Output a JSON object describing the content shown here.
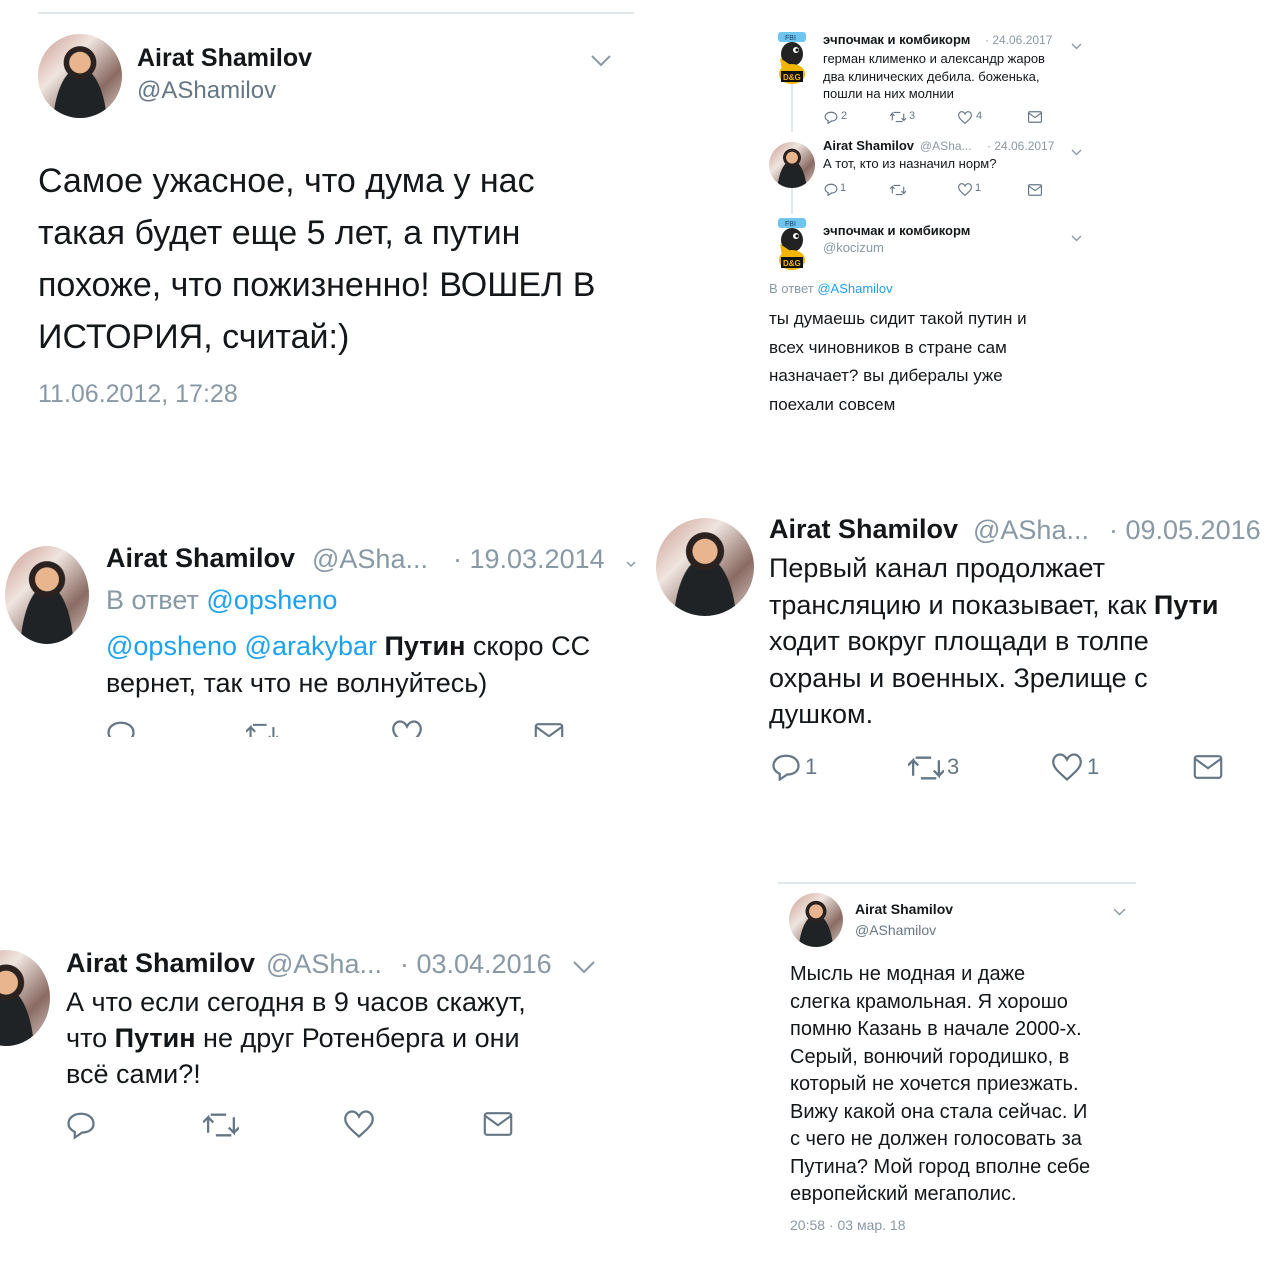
{
  "tweet1": {
    "name": "Airat Shamilov",
    "handle": "@AShamilov",
    "text": "Самое ужасное, что дума у нас\nтакая будет еще 5 лет, а путин\nпохоже, что пожизненно! ВОШЕЛ В\nИСТОРИЯ, считай:)",
    "timestamp": "11.06.2012, 17:28"
  },
  "thread": {
    "t1": {
      "name": "эчпочмак и комбикорм",
      "date": "· 24.06.2017",
      "text": "герман клименко и александр жаров\nдва клинических дебила. боженька,\nпошли на них молнии",
      "replies": "2",
      "retweets": "3",
      "likes": "4"
    },
    "t2": {
      "name": "Airat Shamilov",
      "handle": "@ASha...",
      "date": "· 24.06.2017",
      "text": "А тот, кто из назначил норм?",
      "replies": "1",
      "likes": "1"
    },
    "t3": {
      "name": "эчпочмак и комбикорм",
      "handle": "@kocizum",
      "reply_prefix": "В ответ",
      "reply_to": "@AShamilov",
      "text": "ты думаешь сидит такой путин и\nвсех чиновников в стране сам\nназначает? вы дибералы уже\nпоехали совсем"
    }
  },
  "tweet3": {
    "name": "Airat Shamilov",
    "handle": "@ASha...",
    "date": "· 19.03.2014",
    "reply_prefix": "В ответ",
    "reply_to": "@opsheno",
    "mention1": "@opsheno",
    "mention2": "@arakybar",
    "bold": "Путин",
    "text_a": " скоро СС",
    "text_b": "вернет, так что не волнуйтесь)"
  },
  "tweet4": {
    "name": "Airat Shamilov",
    "handle": "@ASha...",
    "date": "· 09.05.2016",
    "line1": "Первый канал продолжает",
    "line2a": "трансляцию и показывает, как ",
    "line2b": "Пути",
    "line3": "ходит вокруг площади в толпе",
    "line4": "охраны и военных. Зрелище с",
    "line5": "душком.",
    "replies": "1",
    "retweets": "3",
    "likes": "1"
  },
  "tweet5": {
    "name": "Airat Shamilov",
    "handle": "@ASha...",
    "date": "· 03.04.2016",
    "line1": "А что если сегодня в 9 часов скажут,",
    "line2a": "что ",
    "line2b": "Путин",
    "line2c": " не друг Ротенберга и они",
    "line3": "всё сами?!"
  },
  "tweet6": {
    "name": "Airat Shamilov",
    "handle": "@AShamilov",
    "text": "Мысль не модная и даже\nслегка крамольная. Я хорошо\nпомню Казань в начале 2000-х.\nСерый, вонючий городишко, в\nкоторый не хочется приезжать.\nВижу какой она стала сейчас. И\nс чего не должен голосовать за\nПутина? Мой город вполне себе\nевропейский мегаполис.",
    "timestamp": "20:58 · 03 мар. 18"
  },
  "icons": [
    "reply-icon",
    "retweet-icon",
    "like-icon",
    "message-icon",
    "chevron-down-icon"
  ]
}
